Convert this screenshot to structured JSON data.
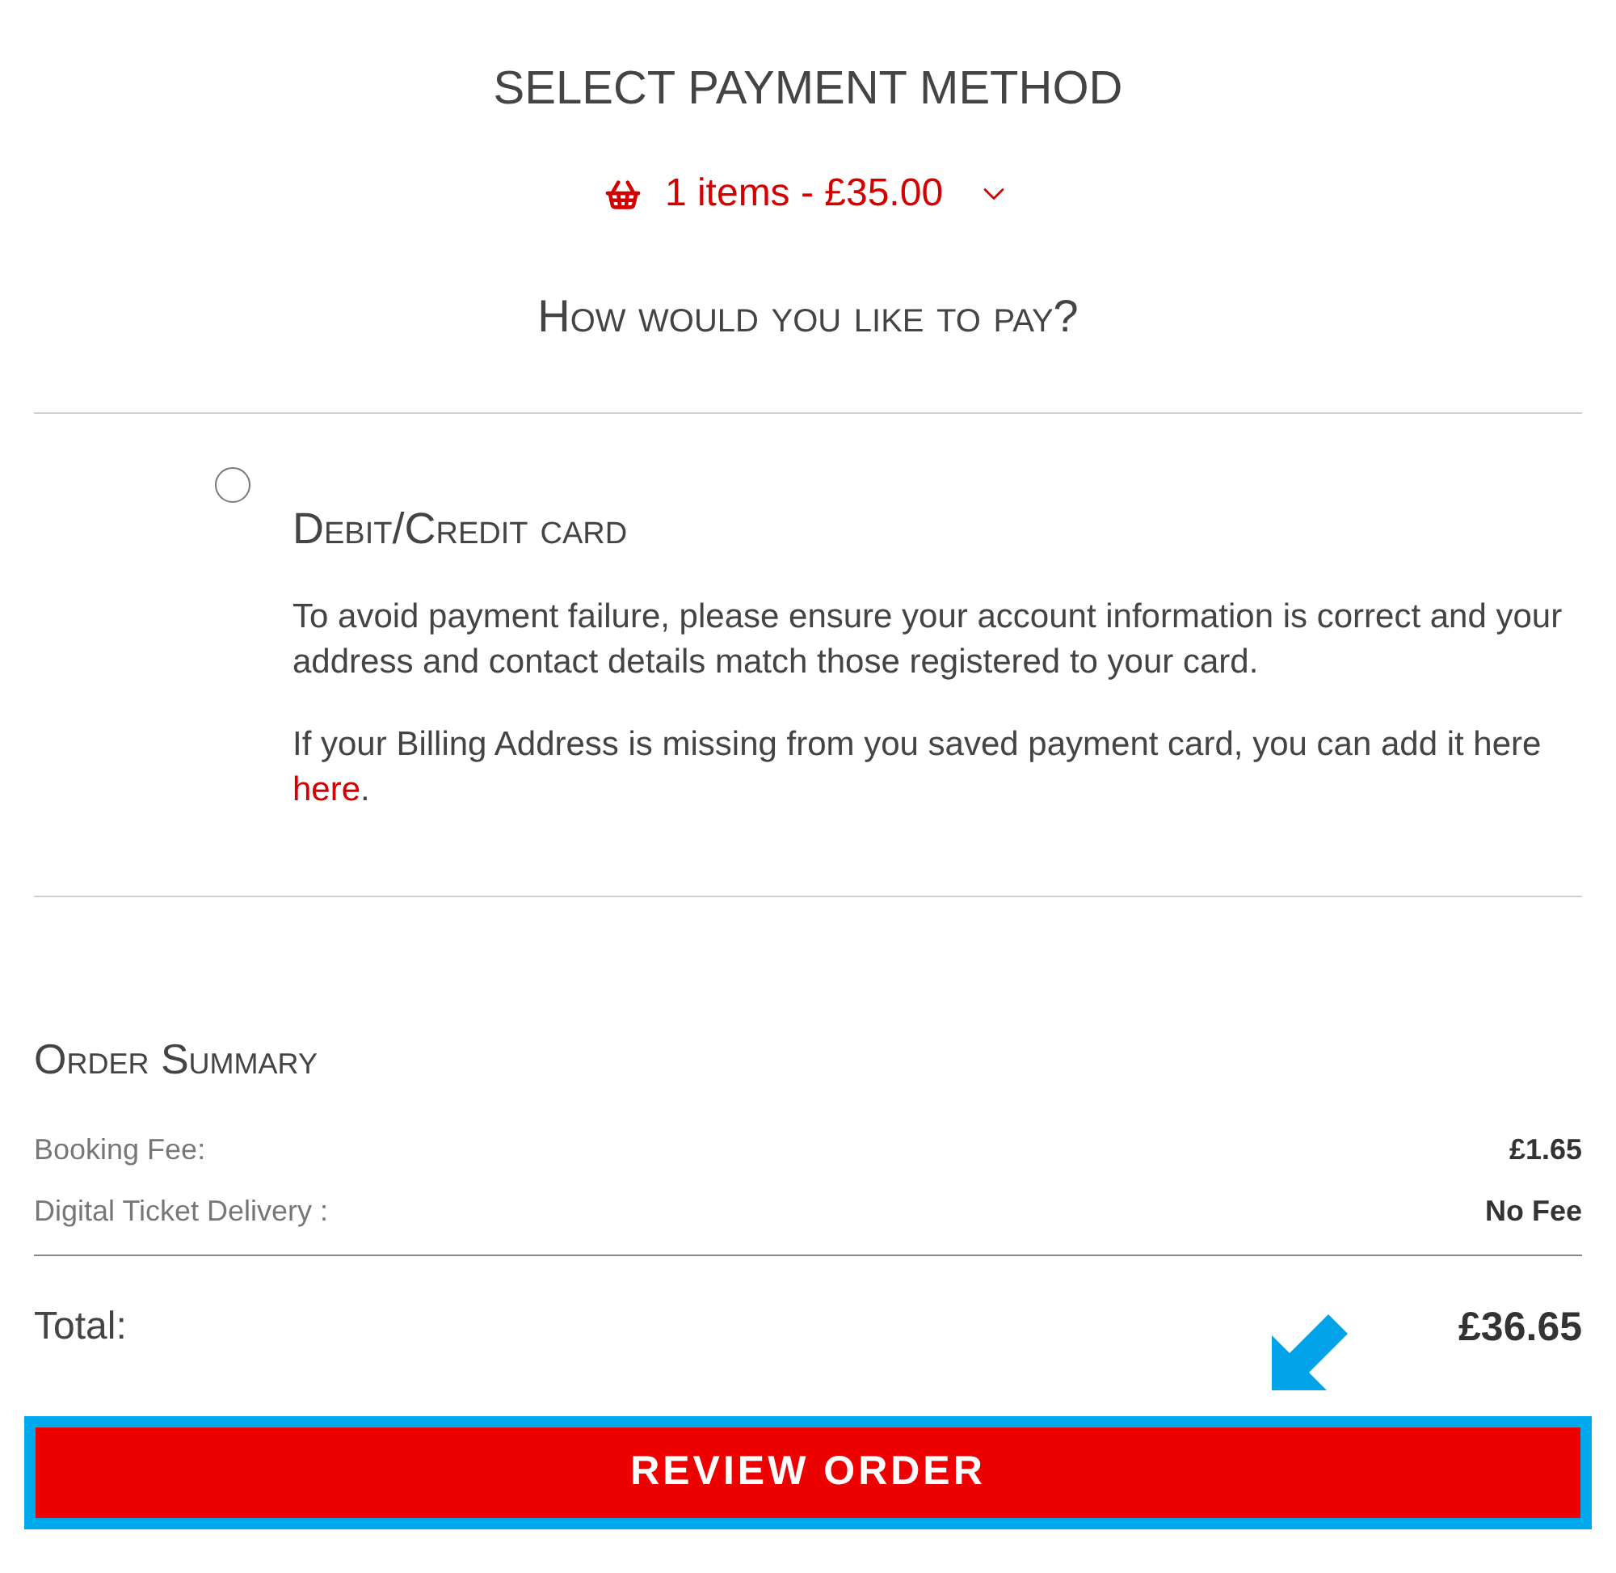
{
  "page": {
    "title": "SELECT PAYMENT METHOD"
  },
  "basket": {
    "summary": "1 items - £35.00",
    "expanded": false
  },
  "question": "How would you like to pay?",
  "payment_methods": [
    {
      "label": "Debit/Credit card",
      "selected": false,
      "notes": [
        {
          "text": "To avoid payment failure, please ensure your account information is correct and your address and contact details match those registered to your card."
        },
        {
          "text": "If your Billing Address is missing from you saved payment card, you can add it here",
          "link": "here",
          "after": "."
        }
      ]
    }
  ],
  "order_summary": {
    "title": "Order Summary",
    "rows": [
      {
        "label": "Booking Fee:",
        "value": "£1.65"
      },
      {
        "label": "Digital Ticket Delivery :",
        "value": "No Fee"
      }
    ],
    "total": {
      "label": "Total:",
      "value": "£36.65"
    }
  },
  "review_button": {
    "label": "REVIEW ORDER",
    "highlighted": true
  }
}
